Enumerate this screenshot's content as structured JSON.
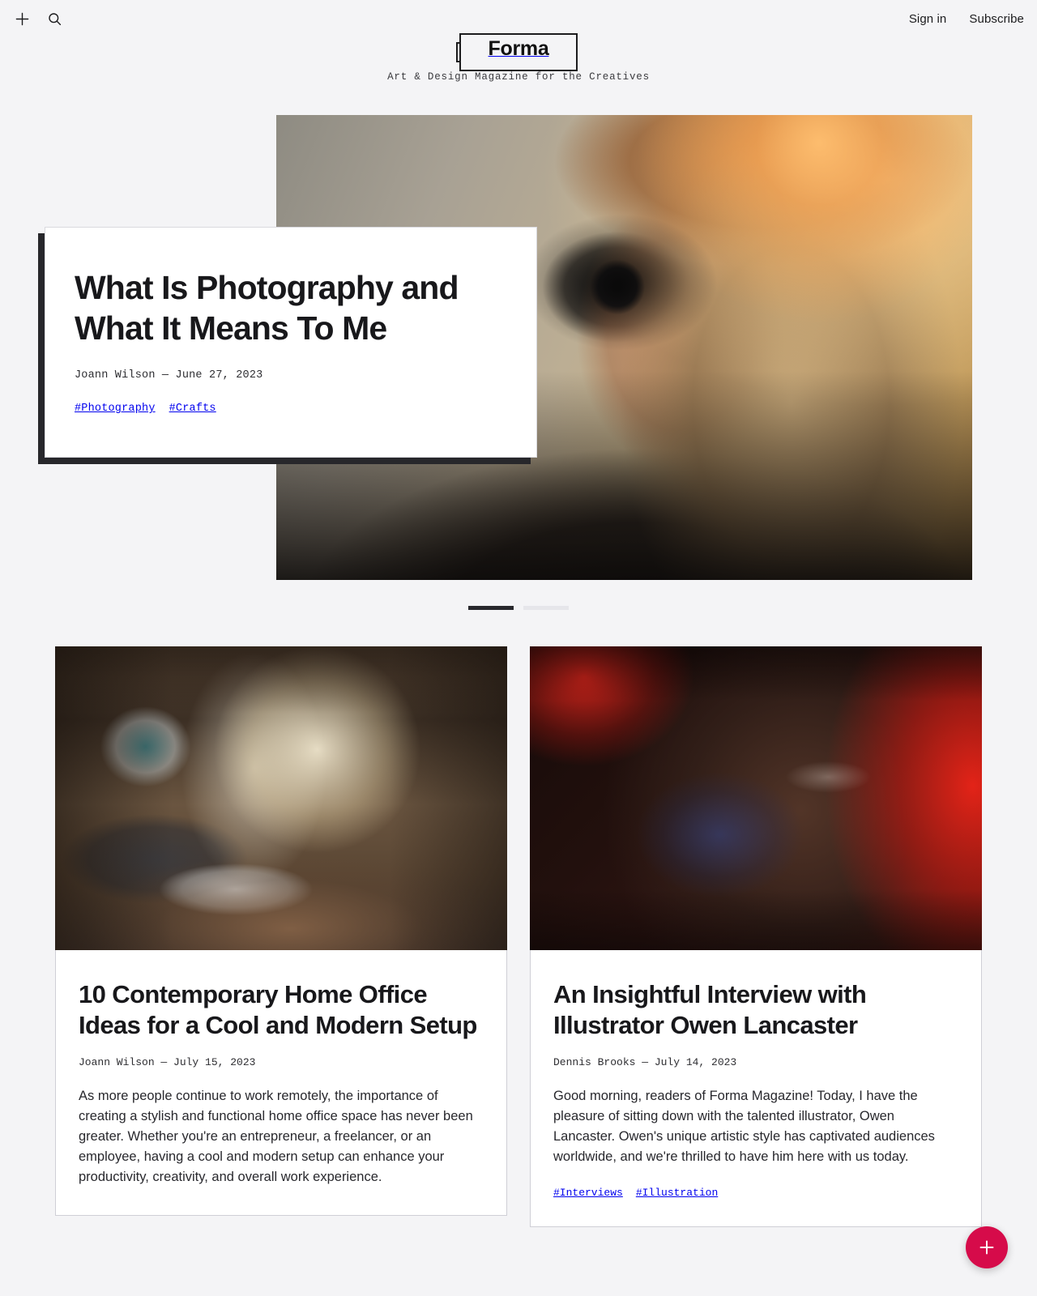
{
  "topbar": {
    "add_icon": "plus-icon",
    "search_icon": "search-icon",
    "signin_label": "Sign in",
    "subscribe_label": "Subscribe"
  },
  "masthead": {
    "logo": "Forma",
    "tagline": "Art & Design Magazine for the Creatives"
  },
  "hero": {
    "image_alt": "woman-with-camera-photo",
    "title": "What Is Photography and What It Means To Me",
    "meta": "Joann Wilson — June 27, 2023",
    "tags": [
      "#Photography",
      "#Crafts"
    ]
  },
  "carousel": {
    "slides": 2,
    "active_index": 0
  },
  "articles": [
    {
      "image_alt": "home-office-interior-photo",
      "title": "10 Contemporary Home Office Ideas for a Cool and Modern Setup",
      "meta": "Joann Wilson — July 15, 2023",
      "excerpt": "As more people continue to work remotely, the importance of creating a stylish and functional home office space has never been greater. Whether you're an entrepreneur, a freelancer, or an employee, having a cool and modern setup can enhance your productivity, creativity, and overall work experience.",
      "tags": []
    },
    {
      "image_alt": "portrait-red-light-photo",
      "title": "An Insightful Interview with Illustrator Owen Lancaster",
      "meta": "Dennis Brooks — July 14, 2023",
      "excerpt": "Good morning, readers of Forma Magazine! Today, I have the pleasure of sitting down with the talented illustrator, Owen Lancaster. Owen's unique artistic style has captivated audiences worldwide, and we're thrilled to have him here with us today.",
      "tags": [
        "#Interviews",
        "#Illustration"
      ]
    }
  ],
  "fab": {
    "icon": "plus-icon",
    "color": "#d60b4a"
  },
  "colors": {
    "background": "#f4f4f6",
    "text": "#18181b",
    "card": "#ffffff",
    "shadow": "#27272b",
    "accent": "#d60b4a",
    "dot_active": "#28282d",
    "dot_inactive": "#e6e6ea"
  }
}
